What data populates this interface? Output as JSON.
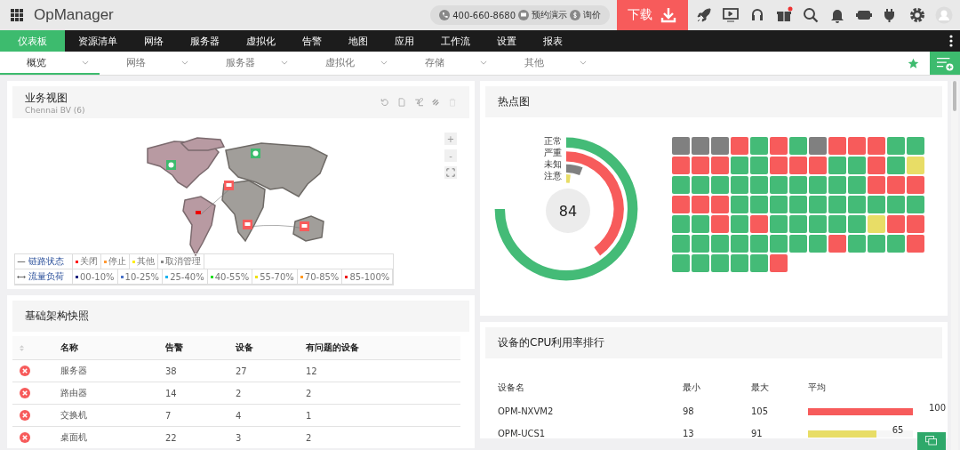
{
  "header": {
    "app_name": "OpManager",
    "phone": "400-660-8680",
    "demo": "预约演示",
    "price": "询价",
    "download": "下载"
  },
  "menu": [
    {
      "label": "仪表板",
      "selected": true
    },
    {
      "label": "资源清单",
      "selected": false
    },
    {
      "label": "网络",
      "selected": false
    },
    {
      "label": "服务器",
      "selected": false
    },
    {
      "label": "虚拟化",
      "selected": false
    },
    {
      "label": "告警",
      "selected": false
    },
    {
      "label": "地图",
      "selected": false
    },
    {
      "label": "应用",
      "selected": false
    },
    {
      "label": "工作流",
      "selected": false
    },
    {
      "label": "设置",
      "selected": false
    },
    {
      "label": "报表",
      "selected": false
    }
  ],
  "subtabs": [
    {
      "label": "概览",
      "selected": true
    },
    {
      "label": "网络",
      "selected": false
    },
    {
      "label": "服务器",
      "selected": false
    },
    {
      "label": "虚拟化",
      "selected": false
    },
    {
      "label": "存储",
      "selected": false
    },
    {
      "label": "其他",
      "selected": false
    }
  ],
  "business_view": {
    "title": "业务视图",
    "subtitle": "Chennai BV (6)",
    "zoom_in": "+",
    "zoom_out": "-",
    "legend_rows": [
      {
        "label": "链路状态",
        "kind": "line",
        "items": [
          {
            "label": "关闭",
            "color": "#ff0000"
          },
          {
            "label": "停止",
            "color": "#ff9933"
          },
          {
            "label": "其他",
            "color": "#ffee00"
          },
          {
            "label": "取消管理",
            "color": "#888888"
          }
        ]
      },
      {
        "label": "流量负荷",
        "kind": "arrow",
        "items": [
          {
            "label": "00-10%",
            "color": "#1a237e"
          },
          {
            "label": "10-25%",
            "color": "#4a72c8"
          },
          {
            "label": "25-40%",
            "color": "#1ab2f0"
          },
          {
            "label": "40-55%",
            "color": "#22dd22"
          },
          {
            "label": "55-70%",
            "color": "#f0e000"
          },
          {
            "label": "70-85%",
            "color": "#ff9922"
          },
          {
            "label": "85-100%",
            "color": "#ee0000"
          }
        ]
      }
    ]
  },
  "infra": {
    "title": "基础架构快照",
    "columns": [
      "名称",
      "告警",
      "设备",
      "有问题的设备"
    ],
    "rows": [
      [
        "服务器",
        "38",
        "27",
        "12"
      ],
      [
        "路由器",
        "14",
        "2",
        "2"
      ],
      [
        "交换机",
        "7",
        "4",
        "1"
      ],
      [
        "桌面机",
        "22",
        "3",
        "2"
      ]
    ]
  },
  "heatmap": {
    "title": "热点图",
    "total": "84",
    "rings": [
      {
        "label": "正常",
        "color": "#44bb77"
      },
      {
        "label": "严重",
        "color": "#f75b5b"
      },
      {
        "label": "未知",
        "color": "#808080"
      },
      {
        "label": "注意",
        "color": "#e8dd66"
      }
    ],
    "rows": [
      [
        {
          "color": "#808080"
        },
        {
          "color": "#808080"
        },
        {
          "color": "#808080"
        },
        {
          "color": "#f75b5b"
        },
        {
          "color": "#44bb77"
        },
        {
          "color": "#f75b5b"
        },
        {
          "color": "#44bb77"
        },
        {
          "color": "#808080"
        },
        {
          "color": "#f75b5b"
        },
        {
          "color": "#f75b5b"
        },
        {
          "color": "#f75b5b"
        },
        {
          "color": "#44bb77"
        },
        {
          "color": "#44bb77"
        }
      ],
      [
        {
          "color": "#f75b5b"
        },
        {
          "color": "#f75b5b"
        },
        {
          "color": "#f75b5b"
        },
        {
          "color": "#44bb77"
        },
        {
          "color": "#44bb77"
        },
        {
          "color": "#f75b5b"
        },
        {
          "color": "#f75b5b"
        },
        {
          "color": "#f75b5b"
        },
        {
          "color": "#44bb77"
        },
        {
          "color": "#44bb77"
        },
        {
          "color": "#f75b5b"
        },
        {
          "color": "#44bb77"
        },
        {
          "color": "#e8dd66"
        }
      ],
      [
        {
          "color": "#44bb77"
        },
        {
          "color": "#44bb77"
        },
        {
          "color": "#44bb77"
        },
        {
          "color": "#44bb77"
        },
        {
          "color": "#44bb77"
        },
        {
          "color": "#44bb77"
        },
        {
          "color": "#44bb77"
        },
        {
          "color": "#44bb77"
        },
        {
          "color": "#44bb77"
        },
        {
          "color": "#44bb77"
        },
        {
          "color": "#f75b5b"
        },
        {
          "color": "#f75b5b"
        },
        {
          "color": "#f75b5b"
        }
      ],
      [
        {
          "color": "#f75b5b"
        },
        {
          "color": "#f75b5b"
        },
        {
          "color": "#f75b5b"
        },
        {
          "color": "#44bb77"
        },
        {
          "color": "#44bb77"
        },
        {
          "color": "#44bb77"
        },
        {
          "color": "#44bb77"
        },
        {
          "color": "#44bb77"
        },
        {
          "color": "#44bb77"
        },
        {
          "color": "#44bb77"
        },
        {
          "color": "#44bb77"
        },
        {
          "color": "#44bb77"
        },
        {
          "color": "#44bb77"
        }
      ],
      [
        {
          "color": "#44bb77"
        },
        {
          "color": "#44bb77"
        },
        {
          "color": "#f75b5b"
        },
        {
          "color": "#44bb77"
        },
        {
          "color": "#f75b5b"
        },
        {
          "color": "#44bb77"
        },
        {
          "color": "#44bb77"
        },
        {
          "color": "#44bb77"
        },
        {
          "color": "#44bb77"
        },
        {
          "color": "#44bb77"
        },
        {
          "color": "#e8dd66"
        },
        {
          "color": "#f75b5b"
        },
        {
          "color": "#f75b5b"
        }
      ],
      [
        {
          "color": "#44bb77"
        },
        {
          "color": "#44bb77"
        },
        {
          "color": "#44bb77"
        },
        {
          "color": "#44bb77"
        },
        {
          "color": "#44bb77"
        },
        {
          "color": "#44bb77"
        },
        {
          "color": "#44bb77"
        },
        {
          "color": "#44bb77"
        },
        {
          "color": "#f75b5b"
        },
        {
          "color": "#44bb77"
        },
        {
          "color": "#44bb77"
        },
        {
          "color": "#44bb77"
        },
        {
          "color": "#f75b5b"
        }
      ],
      [
        {
          "color": "#44bb77"
        },
        {
          "color": "#44bb77"
        },
        {
          "color": "#44bb77"
        },
        {
          "color": "#44bb77"
        },
        {
          "color": "#44bb77"
        },
        {
          "color": "#f75b5b"
        }
      ]
    ]
  },
  "cpu": {
    "title": "设备的CPU利用率排行",
    "columns": [
      "设备名",
      "最小",
      "最大",
      "平均"
    ],
    "rows": [
      {
        "name": "OPM-NXVM2",
        "min": "98",
        "max": "105",
        "avg": "100",
        "level": 1.0,
        "color": "#f75b5b"
      },
      {
        "name": "OPM-UCS1",
        "min": "13",
        "max": "91",
        "avg": "65",
        "level": 0.65,
        "color": "#e8dd66"
      }
    ]
  }
}
